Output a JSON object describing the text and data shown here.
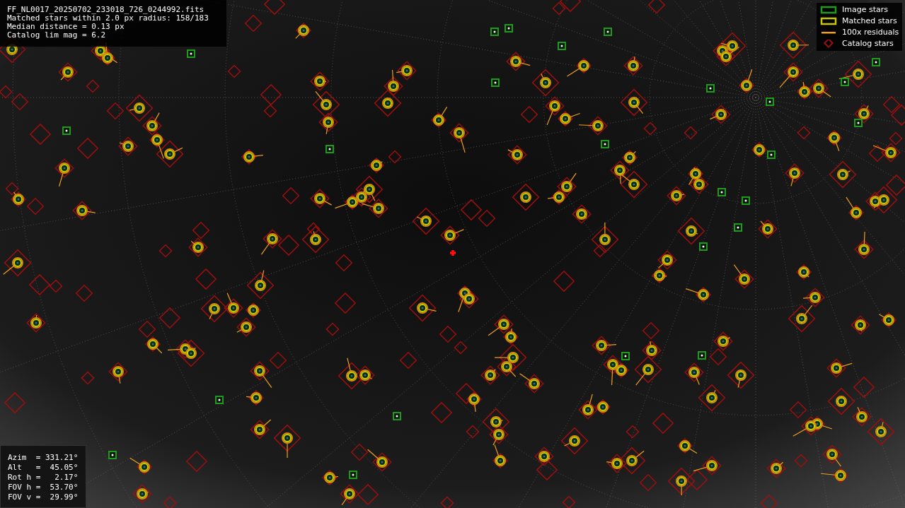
{
  "header": {
    "lines": [
      "FF_NL0017_20250702_233018_726_0244992.fits",
      "Matched stars within 2.0 px radius: 158/183",
      "Median distance = 0.13 px",
      "Catalog lim mag = 6.2"
    ]
  },
  "legend": [
    {
      "label": "Image stars",
      "kind": "box",
      "color": "#1f9a1f"
    },
    {
      "label": "Matched stars",
      "kind": "box",
      "color": "#c8c800"
    },
    {
      "label": "100x residuals",
      "kind": "line",
      "color": "#f0a020"
    },
    {
      "label": "Catalog stars",
      "kind": "diamond",
      "color": "#9a1010"
    }
  ],
  "pointing": {
    "lines": [
      "Azim  = 331.21°",
      "Alt   =  45.05°",
      "Rot h =   2.17°",
      "FOV h =  53.70°",
      "FOV v =  29.99°"
    ]
  }
}
